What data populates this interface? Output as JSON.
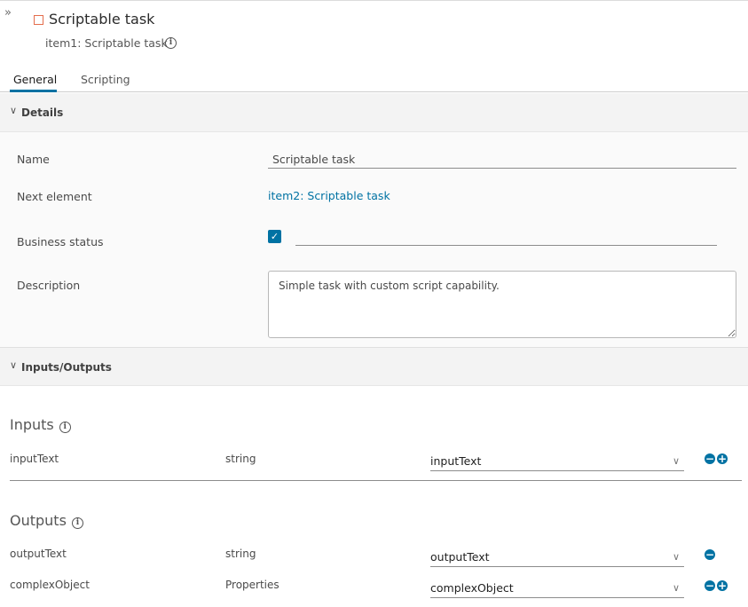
{
  "header": {
    "collapse_icon": "double-chevron-right-icon",
    "title": "Scriptable task",
    "subtitle": "item1: Scriptable task",
    "title_icon_color": "#e46d4c"
  },
  "tabs": [
    {
      "label": "General",
      "active": true
    },
    {
      "label": "Scripting",
      "active": false
    }
  ],
  "details": {
    "section_label": "Details",
    "fields": {
      "name_label": "Name",
      "name_value": "Scriptable task",
      "next_label": "Next element",
      "next_value": "item2: Scriptable task",
      "status_label": "Business status",
      "status_checked": true,
      "status_value": "",
      "description_label": "Description",
      "description_value": "Simple task with custom script capability."
    }
  },
  "io": {
    "section_label": "Inputs/Outputs",
    "inputs_heading": "Inputs",
    "outputs_heading": "Outputs",
    "inputs": [
      {
        "name": "inputText",
        "type": "string",
        "binding": "inputText"
      }
    ],
    "outputs": [
      {
        "name": "outputText",
        "type": "string",
        "binding": "outputText"
      },
      {
        "name": "complexObject",
        "type": "Properties",
        "binding": "complexObject"
      }
    ]
  },
  "colors": {
    "accent": "#0072a3",
    "section_bg": "#f3f3f3"
  }
}
